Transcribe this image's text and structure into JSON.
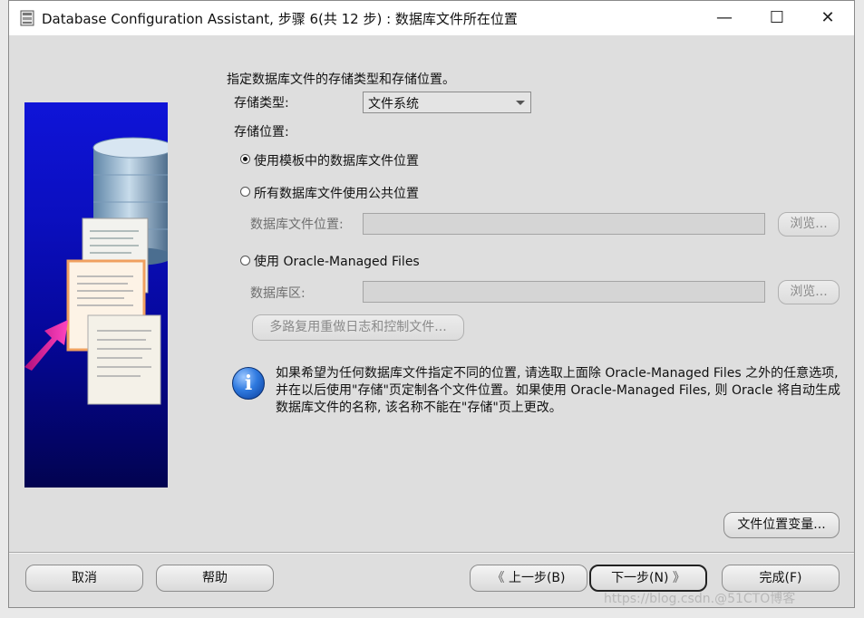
{
  "window": {
    "title": "Database Configuration Assistant, 步骤 6(共 12 步) : 数据库文件所在位置",
    "minimize": "—",
    "maximize": "☐",
    "close": "✕"
  },
  "form": {
    "heading": "指定数据库文件的存储类型和存储位置。",
    "storage_type_label": "存储类型:",
    "storage_type_value": "文件系统",
    "storage_location_label": "存储位置:",
    "option_template": "使用模板中的数据库文件位置",
    "option_common": "所有数据库文件使用公共位置",
    "db_file_location_label": "数据库文件位置:",
    "browse1": "浏览...",
    "option_omf": "使用 Oracle-Managed Files",
    "db_area_label": "数据库区:",
    "browse2": "浏览...",
    "multiplex_button": "多路复用重做日志和控制文件...",
    "info_text": "如果希望为任何数据库文件指定不同的位置, 请选取上面除 Oracle-Managed Files 之外的任意选项, 并在以后使用\"存储\"页定制各个文件位置。如果使用 Oracle-Managed Files, 则 Oracle 将自动生成数据库文件的名称, 该名称不能在\"存储\"页上更改。",
    "file_location_vars_button": "文件位置变量..."
  },
  "footer": {
    "cancel": "取消",
    "help": "帮助",
    "back": "上一步(B)",
    "next": "下一步(N)",
    "finish": "完成(F)"
  },
  "watermark": "https://blog.csdn.@51CTO博客",
  "colors": {
    "art_top": "#0f14d8",
    "art_bottom": "#020350",
    "accent_arrow": "#e6229a"
  },
  "icons": [
    "app-icon",
    "info-icon",
    "database-cylinder",
    "document",
    "arrow",
    "chevron-left-icon",
    "chevron-right-icon"
  ]
}
